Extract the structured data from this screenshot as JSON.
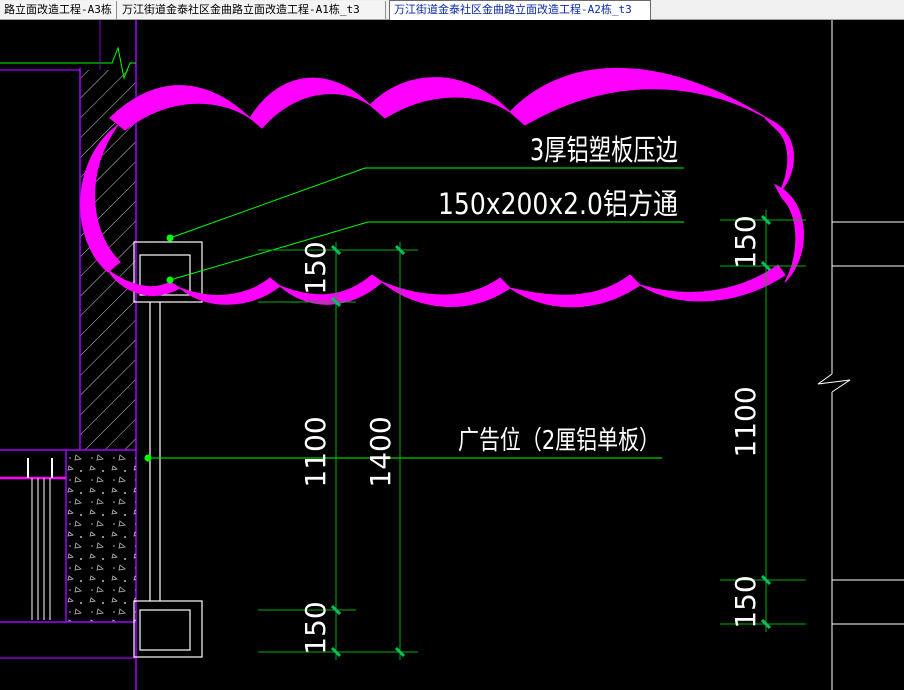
{
  "tabs": [
    {
      "label": "路立面改造工程-A3栋"
    },
    {
      "label": "万江街道金泰社区金曲路立面改造工程-A1栋_t3"
    },
    {
      "label": "万江街道金泰社区金曲路立面改造工程-A2栋_t3"
    }
  ],
  "drawing": {
    "callout_1": "3厚铝塑板压边",
    "callout_2": "150x200x2.0铝方通",
    "callout_3": "广告位（2厘铝单板）",
    "dim_top_left": "150",
    "dim_middle_left": "1100",
    "dim_total_left": "1400",
    "dim_bottom_left": "150",
    "dim_top_right": "150",
    "dim_middle_right": "1100",
    "dim_bottom_right": "150"
  },
  "colors": {
    "background": "#000000",
    "revision_cloud": "#ff00ff",
    "leader_lines": "#00ff00",
    "outline": "#ffffff",
    "wall_line": "#a000ff",
    "dimension": "#00b000",
    "tick": "#00c060"
  }
}
